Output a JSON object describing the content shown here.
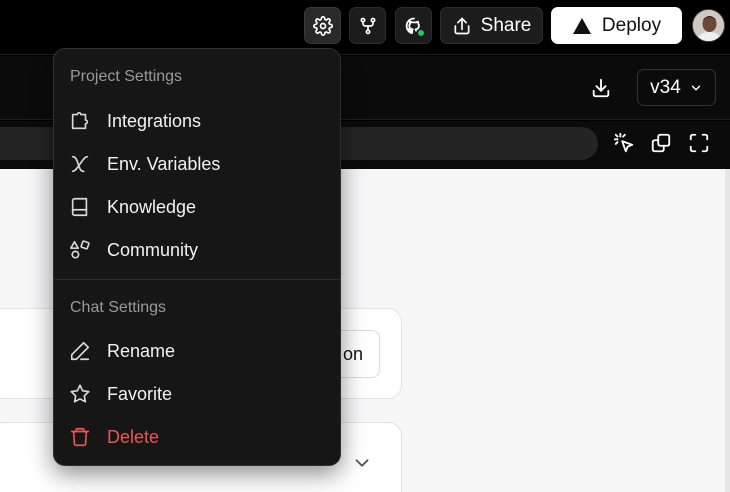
{
  "topbar": {
    "share_label": "Share",
    "deploy_label": "Deploy",
    "icons": [
      "gear-icon",
      "git-branch-icon",
      "github-icon"
    ]
  },
  "toolbar": {
    "version": "v34"
  },
  "menu": {
    "project_header": "Project Settings",
    "project_items": [
      {
        "label": "Integrations",
        "icon": "puzzle-icon"
      },
      {
        "label": "Env. Variables",
        "icon": "variable-icon"
      },
      {
        "label": "Knowledge",
        "icon": "book-icon"
      },
      {
        "label": "Community",
        "icon": "shapes-icon"
      }
    ],
    "chat_header": "Chat Settings",
    "chat_items": [
      {
        "label": "Rename",
        "icon": "pencil-icon"
      },
      {
        "label": "Favorite",
        "icon": "star-icon"
      },
      {
        "label": "Delete",
        "icon": "trash-icon"
      }
    ]
  },
  "content": {
    "card_button_label": "on"
  },
  "colors": {
    "danger": "#ef5454",
    "status_dot": "#22c55e"
  }
}
